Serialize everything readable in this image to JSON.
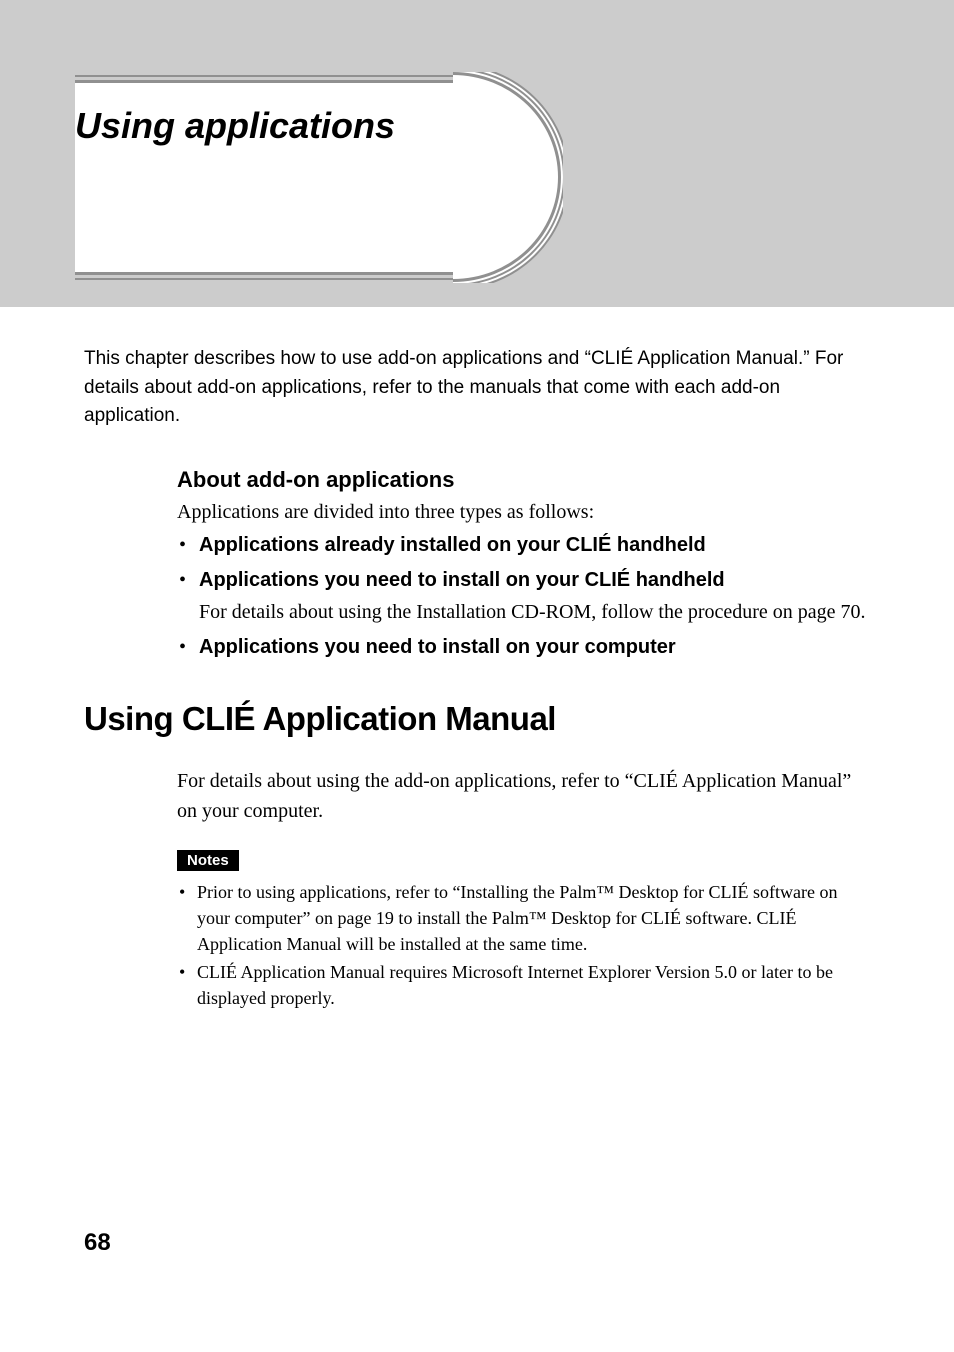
{
  "chapter_title": "Using applications",
  "intro": "This chapter describes how to use add-on applications and “CLIÉ Application Manual.” For details about add-on applications, refer to the manuals that come with each add-on application.",
  "section1": {
    "heading": "About add-on applications",
    "intro": "Applications are divided into three types as follows:",
    "bullets": [
      {
        "title": "Applications already installed on your CLIÉ handheld",
        "detail": ""
      },
      {
        "title": "Applications you need to install on your CLIÉ handheld",
        "detail": "For details about using the Installation CD-ROM, follow the procedure on page 70."
      },
      {
        "title": "Applications you need to install on your computer",
        "detail": ""
      }
    ]
  },
  "main_heading": "Using CLIÉ Application Manual",
  "body": "For details about using the add-on applications, refer to “CLIÉ Application Manual” on your computer.",
  "notes_label": "Notes",
  "notes": [
    "Prior to using applications, refer to “Installing the Palm™ Desktop for CLIÉ software on your computer” on page 19 to install the Palm™ Desktop for CLIÉ software. CLIÉ Application Manual will be installed at the same time.",
    "CLIÉ Application Manual requires Microsoft Internet Explorer Version 5.0 or later to be displayed properly."
  ],
  "page_number": "68"
}
